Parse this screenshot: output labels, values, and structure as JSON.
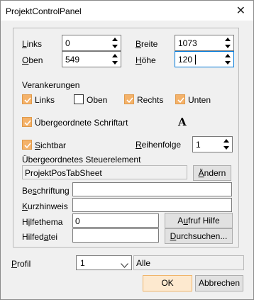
{
  "window": {
    "title": "ProjektControlPanel",
    "close_glyph": "✕"
  },
  "position": {
    "links": {
      "label_key": "L",
      "label_rest": "inks",
      "value": "0"
    },
    "oben": {
      "label_key": "O",
      "label_rest": "ben",
      "value": "549"
    },
    "breite": {
      "label_key": "B",
      "label_rest": "reite",
      "value": "1073"
    },
    "hoehe": {
      "label_key": "H",
      "label_rest": "öhe",
      "value": "120"
    }
  },
  "anchors": {
    "heading": "Verankerungen",
    "links": {
      "label": "Links",
      "checked": true
    },
    "oben": {
      "label": "Oben",
      "checked": false
    },
    "rechts": {
      "label": "Rechts",
      "checked": true
    },
    "unten": {
      "label": "Unten",
      "checked": true
    }
  },
  "font": {
    "label": "Übergeordnete Schriftart",
    "checked": true,
    "sample_glyph": "A"
  },
  "visible": {
    "label_key": "S",
    "label_rest": "ichtbar",
    "checked": true
  },
  "order": {
    "label_key": "R",
    "label_rest": "eihenfolge",
    "value": "1"
  },
  "parent": {
    "heading": "Übergeordnetes Steuerelement",
    "value": "ProjektPosTabSheet",
    "change_button_key": "Ä",
    "change_button_rest": "ndern"
  },
  "caption": {
    "label_pre": "Be",
    "label_key": "s",
    "label_post": "chriftung",
    "value": ""
  },
  "tooltip": {
    "label_pre": "",
    "label_key": "K",
    "label_post": "urzhinweis",
    "value": ""
  },
  "helptopic": {
    "label_pre": "H",
    "label_key": "i",
    "label_post": "lfethema",
    "value": "0",
    "button_pre": "A",
    "button_key": "u",
    "button_post": "fruf Hilfe"
  },
  "helpfile": {
    "label_pre": "Hilfed",
    "label_key": "a",
    "label_post": "tei",
    "value": "",
    "button_key": "D",
    "button_rest": "urchsuchen..."
  },
  "profile": {
    "label_key": "P",
    "label_rest": "rofil",
    "value": "1",
    "description": "Alle"
  },
  "buttons": {
    "ok": "OK",
    "cancel": "Abbrechen"
  },
  "colors": {
    "check_fill": "#f4b26a",
    "focus_border": "#0078d7",
    "default_button": "#fde9cf"
  }
}
